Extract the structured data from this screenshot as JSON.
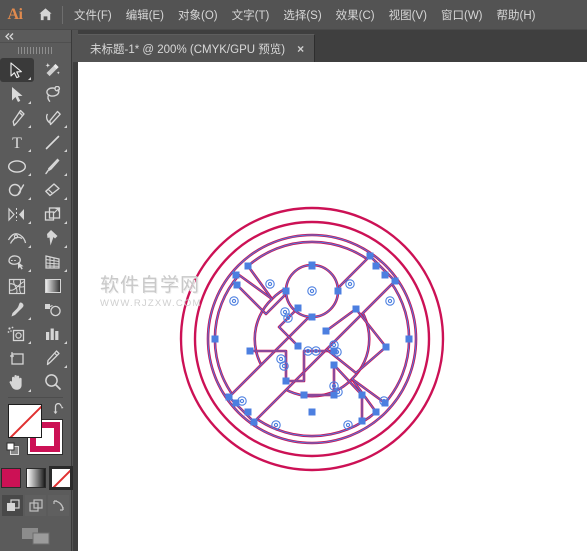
{
  "app": {
    "name": "Adobe Illustrator",
    "logo_text": "Ai",
    "home_icon": "home-icon"
  },
  "menubar": {
    "items": [
      {
        "label": "文件(F)",
        "name": "menu-file"
      },
      {
        "label": "编辑(E)",
        "name": "menu-edit"
      },
      {
        "label": "对象(O)",
        "name": "menu-object"
      },
      {
        "label": "文字(T)",
        "name": "menu-type"
      },
      {
        "label": "选择(S)",
        "name": "menu-select"
      },
      {
        "label": "效果(C)",
        "name": "menu-effect"
      },
      {
        "label": "视图(V)",
        "name": "menu-view"
      },
      {
        "label": "窗口(W)",
        "name": "menu-window"
      },
      {
        "label": "帮助(H)",
        "name": "menu-help"
      }
    ]
  },
  "tabs": {
    "active_index": 0,
    "items": [
      {
        "title": "未标题-1* @ 200% (CMYK/GPU 预览)",
        "close_label": "×",
        "document_name": "未标题-1",
        "modified": true,
        "zoom": "200%",
        "color_mode": "CMYK",
        "preview_mode": "GPU 预览"
      }
    ]
  },
  "toolpanel": {
    "collapse_label": "«",
    "grip": "panel-grip",
    "tools": [
      {
        "name": "selection-tool",
        "title": "选择工具",
        "active": true,
        "has_flyout": true
      },
      {
        "name": "magic-wand-tool",
        "title": "魔棒工具",
        "active": false,
        "has_flyout": false
      },
      {
        "name": "direct-selection-tool",
        "title": "直接选择工具",
        "active": false,
        "has_flyout": true
      },
      {
        "name": "lasso-tool",
        "title": "套索工具",
        "active": false,
        "has_flyout": false
      },
      {
        "name": "pen-tool",
        "title": "钢笔工具",
        "active": false,
        "has_flyout": true
      },
      {
        "name": "curvature-tool",
        "title": "曲率工具",
        "active": false,
        "has_flyout": true
      },
      {
        "name": "type-tool",
        "title": "文字工具",
        "active": false,
        "has_flyout": true
      },
      {
        "name": "line-segment-tool",
        "title": "直线段工具",
        "active": false,
        "has_flyout": true
      },
      {
        "name": "ellipse-tool",
        "title": "椭圆工具",
        "active": false,
        "has_flyout": true
      },
      {
        "name": "paintbrush-tool",
        "title": "画笔工具",
        "active": false,
        "has_flyout": true
      },
      {
        "name": "shaper-tool",
        "title": "Shaper 工具",
        "active": false,
        "has_flyout": true
      },
      {
        "name": "eraser-tool",
        "title": "橡皮擦工具",
        "active": false,
        "has_flyout": true
      },
      {
        "name": "rotate-tool",
        "title": "旋转工具",
        "active": false,
        "has_flyout": true
      },
      {
        "name": "scale-tool",
        "title": "比例缩放工具",
        "active": false,
        "has_flyout": true
      },
      {
        "name": "width-tool",
        "title": "宽度工具",
        "active": false,
        "has_flyout": true
      },
      {
        "name": "free-transform-tool",
        "title": "自由变换工具",
        "active": false,
        "has_flyout": true
      },
      {
        "name": "shape-builder-tool",
        "title": "形状生成器工具",
        "active": false,
        "has_flyout": true
      },
      {
        "name": "perspective-grid-tool",
        "title": "透视网格工具",
        "active": false,
        "has_flyout": true
      },
      {
        "name": "mesh-tool",
        "title": "网格工具",
        "active": false,
        "has_flyout": false
      },
      {
        "name": "gradient-tool",
        "title": "渐变工具",
        "active": false,
        "has_flyout": false
      },
      {
        "name": "eyedropper-tool",
        "title": "吸管工具",
        "active": false,
        "has_flyout": true
      },
      {
        "name": "blend-tool",
        "title": "混合工具",
        "active": false,
        "has_flyout": false
      },
      {
        "name": "symbol-sprayer-tool",
        "title": "符号喷枪工具",
        "active": false,
        "has_flyout": true
      },
      {
        "name": "column-graph-tool",
        "title": "柱形图工具",
        "active": false,
        "has_flyout": true
      },
      {
        "name": "artboard-tool",
        "title": "画板工具",
        "active": false,
        "has_flyout": false
      },
      {
        "name": "slice-tool",
        "title": "切片工具",
        "active": false,
        "has_flyout": true
      },
      {
        "name": "hand-tool",
        "title": "抓手工具",
        "active": false,
        "has_flyout": true
      },
      {
        "name": "zoom-tool",
        "title": "缩放工具",
        "active": false,
        "has_flyout": false
      }
    ],
    "fill_stroke": {
      "fill_value": "无",
      "fill_color": "#ffffff",
      "stroke_color": "#cc1155",
      "swap_label": "↰",
      "default_label": "默认填色和描边"
    },
    "color_modes": [
      {
        "name": "color-mode-solid",
        "label": "颜色",
        "selected": false,
        "color": "#cc1155"
      },
      {
        "name": "color-mode-gradient",
        "label": "渐变",
        "selected": false
      },
      {
        "name": "color-mode-none",
        "label": "无",
        "selected": true
      }
    ],
    "draw_modes": [
      {
        "name": "draw-normal",
        "label": "正常绘图",
        "active": true
      },
      {
        "name": "draw-behind",
        "label": "背面绘图",
        "active": false
      },
      {
        "name": "draw-inside",
        "label": "内部绘图",
        "active": false
      }
    ],
    "screen_mode": {
      "name": "screen-mode-button",
      "label": "更改屏幕模式"
    }
  },
  "canvas": {
    "background": "#ffffff",
    "artwork": {
      "name": "circular-emblem-artwork",
      "stroke_color": "#cc1155",
      "selection_color": "#4c7fe0",
      "anchor_color": "#4c7fe0",
      "selected": true,
      "description": "圆形徽章图形（选中状态，显示锚点与路径）"
    },
    "watermark": {
      "chinese": "软件自学网",
      "url": "WWW.RJZXW.COM"
    }
  }
}
